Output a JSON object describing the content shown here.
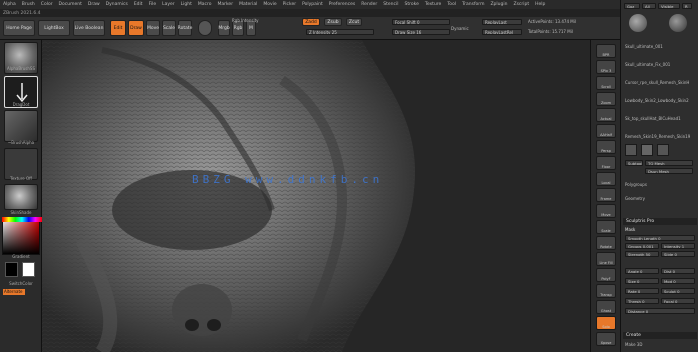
{
  "menu": [
    "Alpha",
    "Brush",
    "Color",
    "Document",
    "Draw",
    "Dynamics",
    "Edit",
    "File",
    "Layer",
    "Light",
    "Macro",
    "Marker",
    "Material",
    "Movie",
    "Picker",
    "Polypaint",
    "Preferences",
    "Render",
    "Stencil",
    "Stroke",
    "Texture",
    "Tool",
    "Transform",
    "Zplugin",
    "Zscript",
    "Help"
  ],
  "infobar": "ZBrush 2021.6.4",
  "toolbar": {
    "home_page": "Home Page",
    "lightbox": "LightBox",
    "live_boolean": "Live Boolean",
    "edit": "Edit",
    "draw": "Draw",
    "move": "Move",
    "scale": "Scale",
    "rotate": "Rotate",
    "mrgb": "Mrgb",
    "rgb": "Rgb",
    "m": "M",
    "zadd": "Zadd",
    "zsub": "Zsub",
    "zcut": "Zcut",
    "rgb_intensity": "Rgb Intensity",
    "z_intensity": "Z Intensity 25",
    "focal_shift": "Focal Shift 0",
    "draw_size": "Draw Size 16",
    "dynamic": "Dynamic",
    "replay_last": "ReplayLast",
    "replay_last_rel": "ReplayLastRel",
    "active_points": "ActivePoints: 13.474 Mil",
    "total_points": "TotalPoints: 15.717 Mil",
    "spotlight": "Spotlight Projection",
    "adjust": "Adjust",
    "ai": "AI"
  },
  "left_shelf": {
    "brush_label": "AlphaBrushSS",
    "stroke_label": "DragDot",
    "alpha_label": "~BrushAlpha",
    "texture_label": "Texture Off",
    "material_label": "SkinShade",
    "gradient_label": "Gradient",
    "switch_color": "SwitchColor",
    "alternate": "Alternate"
  },
  "watermark": "BBZG www.ddnkfb.cn",
  "right_strip": [
    "BPR",
    "SPix 3",
    "Scroll",
    "Zoom",
    "Actual",
    "AAHalf",
    "Persp",
    "Floor",
    "Local",
    "Frame",
    "Move",
    "Scale",
    "Rotate",
    "Line Fill",
    "PolyF",
    "Transp",
    "Ghost",
    "Solo",
    "Xpose"
  ],
  "palette": {
    "top_buttons": [
      "Goz",
      "All",
      "Visible",
      "R"
    ],
    "tool_items": [
      "Skull_ultimate_001",
      "Skull_ultimate_Fix_001",
      "Cursor_rpe_skull_Remesh_SkinH",
      "Lowbody_Skin2_Lowbody_Skin2",
      "Sk_top_skullHat_BlCuHead1",
      "Remesh_Skin19_Remesh_Skin19"
    ],
    "subtool_label": "Subtool",
    "tool_mesh": "TQ Mesh",
    "zoom_mesh": "Dsun Mesh",
    "polygroups": "Polygroups",
    "geometry": "Geometry",
    "section_title": "Sculptris Pro",
    "mask": "Mask",
    "sliders": [
      "Smooth Length 0",
      "Groups 0.001",
      "Intensity 1",
      "Strength 50",
      "Slide 0",
      "Angle 0",
      "Dist 0",
      "Size 0",
      "Mod 0",
      "Rate 0",
      "Sculpt 0",
      "Thresh 0",
      "Focal 0",
      "Distance 0"
    ],
    "create_label": "Create",
    "make_3d": "Make 3D"
  }
}
